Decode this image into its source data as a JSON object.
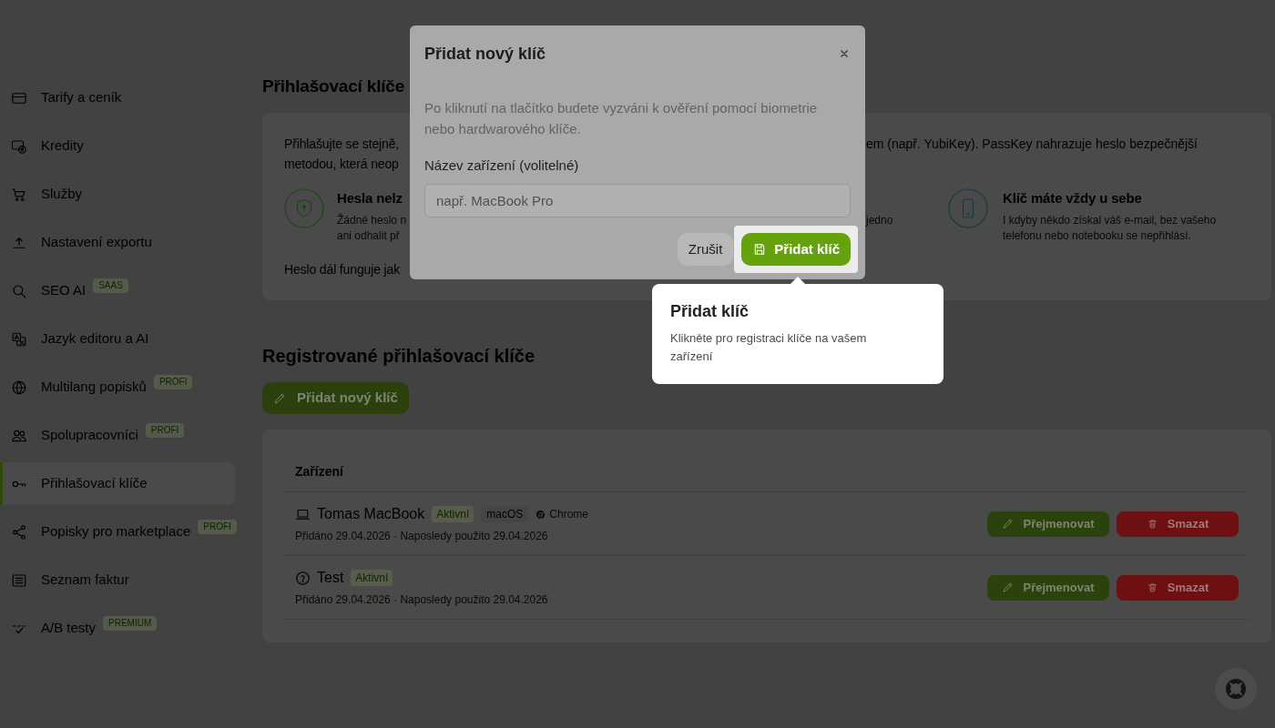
{
  "sidebar": {
    "items": [
      {
        "label": "Tarify a ceník",
        "selected": false
      },
      {
        "label": "Kredity",
        "selected": false
      },
      {
        "label": "Služby",
        "selected": false
      },
      {
        "label": "Nastavení exportu",
        "selected": false
      },
      {
        "label": "SEO AI",
        "badge": "SAAS",
        "selected": false
      },
      {
        "label": "Jazyk editoru a AI",
        "selected": false
      },
      {
        "label": "Multilang popisků",
        "badge": "PROFI",
        "selected": false
      },
      {
        "label": "Spolupracovníci",
        "badge": "PROFI",
        "selected": false
      },
      {
        "label": "Přihlašovací klíče",
        "selected": true
      },
      {
        "label": "Popisky pro marketplace",
        "badge": "PROFI",
        "selected": false
      },
      {
        "label": "Seznam faktur",
        "selected": false
      },
      {
        "label": "A/B testy",
        "badge": "PREMIUM",
        "selected": false
      }
    ]
  },
  "page": {
    "title": "Přihlašovací klíče"
  },
  "intro_card": {
    "paragraph_lines": [
      {
        "start": "Přihlašujte se stejně,",
        "end": "em (např. YubiKey). PassKey nahrazuje heslo bezpečnější"
      },
      {
        "start": "metodou, která neop"
      }
    ],
    "features": [
      {
        "title": "Hesla nelz",
        "lines": [
          "Žádné heslo n",
          "ani odhalit př"
        ]
      },
      {
        "lines": [
          "jedno"
        ]
      },
      {
        "title": "Klíč máte vždy u sebe",
        "text": "I kdyby někdo získal váš e-mail, bez vašeho telefonu nebo notebooku se nepřihlásí."
      }
    ],
    "note": "Heslo dál funguje jak"
  },
  "registered": {
    "title": "Registrované přihlašovací klíče",
    "add_button": "Přidat nový klíč",
    "table": {
      "columns": [
        "Zařízení"
      ],
      "rows": [
        {
          "name": "Tomas MacBook",
          "status": "Aktivní",
          "os": "macOS",
          "browser": "Chrome",
          "meta": "Přidáno 29.04.2026 · Naposledy použito 29.04.2026",
          "actions": [
            {
              "label": "Přejmenovat",
              "kind": "rename"
            },
            {
              "label": "Smazat",
              "kind": "delete"
            }
          ]
        },
        {
          "name": "Test",
          "status": "Aktivní",
          "meta": "Přidáno 29.04.2026 · Naposledy použito 29.04.2026",
          "actions": [
            {
              "label": "Přejmenovat",
              "kind": "rename"
            },
            {
              "label": "Smazat",
              "kind": "delete"
            }
          ]
        }
      ]
    }
  },
  "modal": {
    "title": "Přidat nový klíč",
    "description": "Po kliknutí na tlačítko budete vyzváni k ověření pomocí biometrie nebo hardwarového klíče.",
    "field": {
      "label": "Název zařízení (volitelné)",
      "placeholder": "např. MacBook Pro"
    },
    "buttons": [
      {
        "label": "Zrušit",
        "kind": "secondary",
        "highlighted": false
      },
      {
        "label": "Přidat klíč",
        "kind": "primary",
        "highlighted": true
      }
    ]
  },
  "tour_tooltip": {
    "title": "Přidat klíč",
    "text": "Klikněte pro registraci klíče na vašem zařízení"
  }
}
